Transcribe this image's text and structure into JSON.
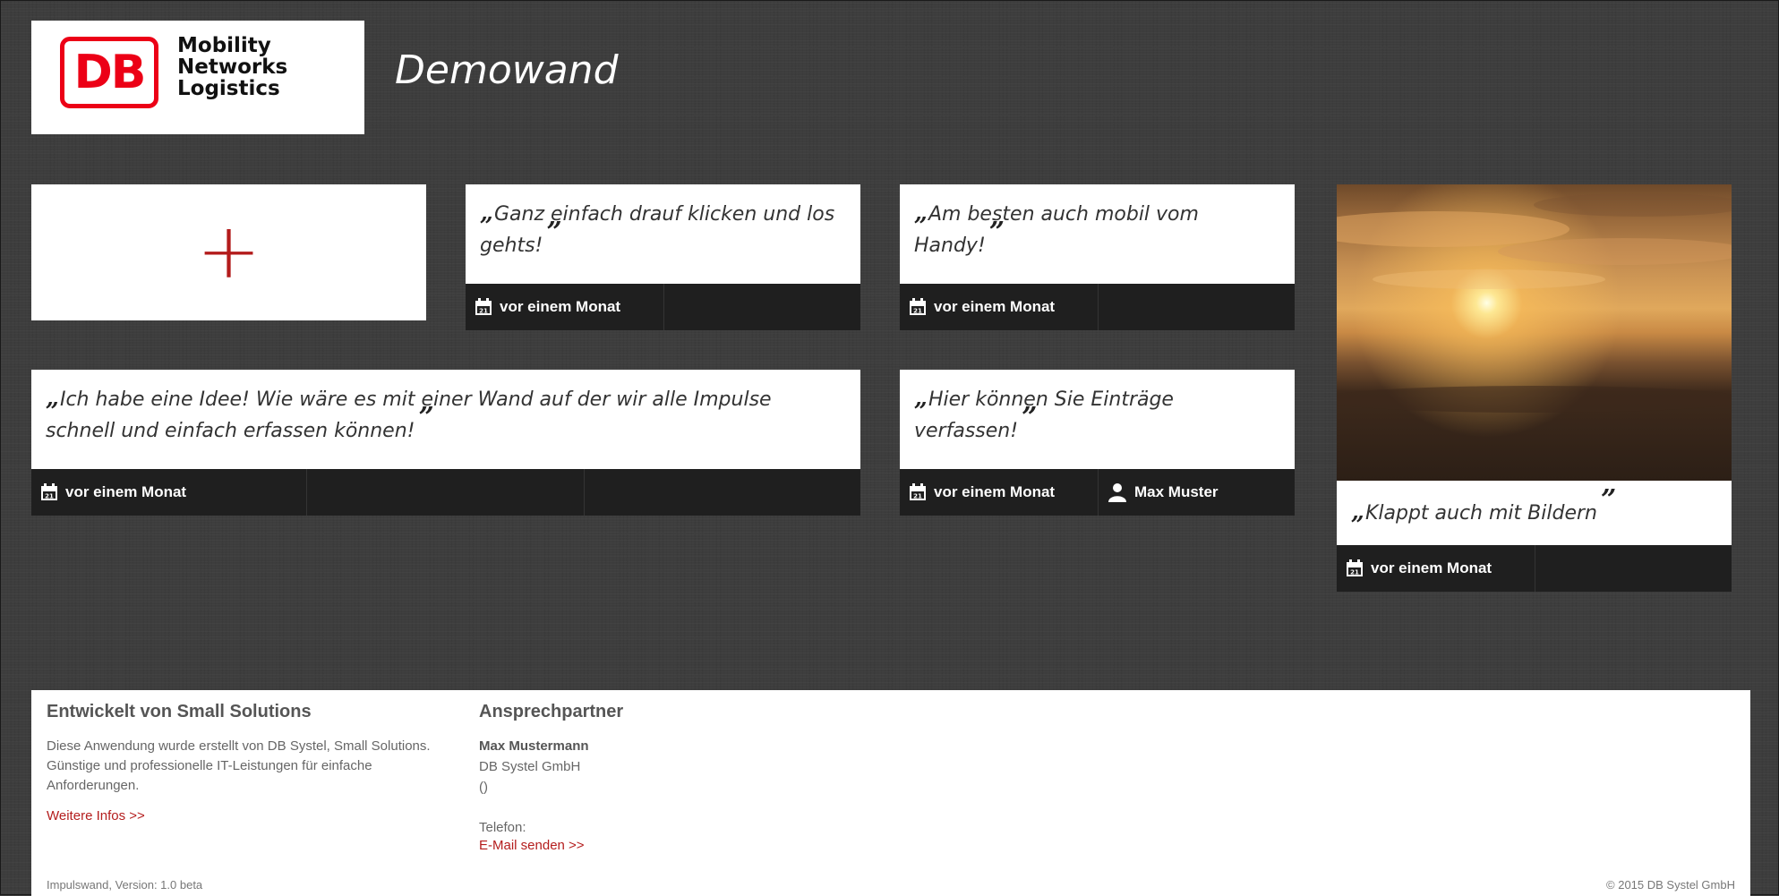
{
  "header": {
    "logo_mark": "DB",
    "logo_lines": [
      "Mobility",
      "Networks",
      "Logistics"
    ],
    "title": "Demowand"
  },
  "add_card": {
    "symbol": "+"
  },
  "cards": [
    {
      "quote": "Ganz einfach drauf klicken und los gehts!",
      "date": "vor einem Monat"
    },
    {
      "quote": "Am besten auch mobil vom Handy!",
      "date": "vor einem Monat"
    },
    {
      "quote": "Ich habe eine Idee! Wie wäre es mit einer Wand auf der wir alle Impulse schnell und einfach erfassen können!",
      "date": "vor einem Monat"
    },
    {
      "quote": "Hier können Sie Einträge verfassen!",
      "date": "vor einem Monat",
      "author": "Max Muster"
    },
    {
      "quote": "Klappt auch mit Bildern",
      "date": "vor einem Monat"
    }
  ],
  "quote_marks": {
    "open": "„",
    "close": "”"
  },
  "footer": {
    "developer": {
      "heading": "Entwickelt von Small Solutions",
      "text": "Diese Anwendung wurde erstellt von DB Systel, Small Solutions. Günstige und professionelle IT-Leistungen für einfache Anforderungen.",
      "link": "Weitere Infos >>"
    },
    "contact": {
      "heading": "Ansprechpartner",
      "name": "Max Mustermann",
      "company": "DB Systel GmbH",
      "parens": "()",
      "phone_label": "Telefon:",
      "email_link": "E-Mail senden >>"
    },
    "version": "Impulswand, Version: 1.0 beta",
    "copyright": "© 2015 DB Systel GmbH"
  },
  "colors": {
    "accent_red": "#ec0016",
    "link_red": "#b41d1d",
    "meta_bar": "#1f1f1f"
  }
}
